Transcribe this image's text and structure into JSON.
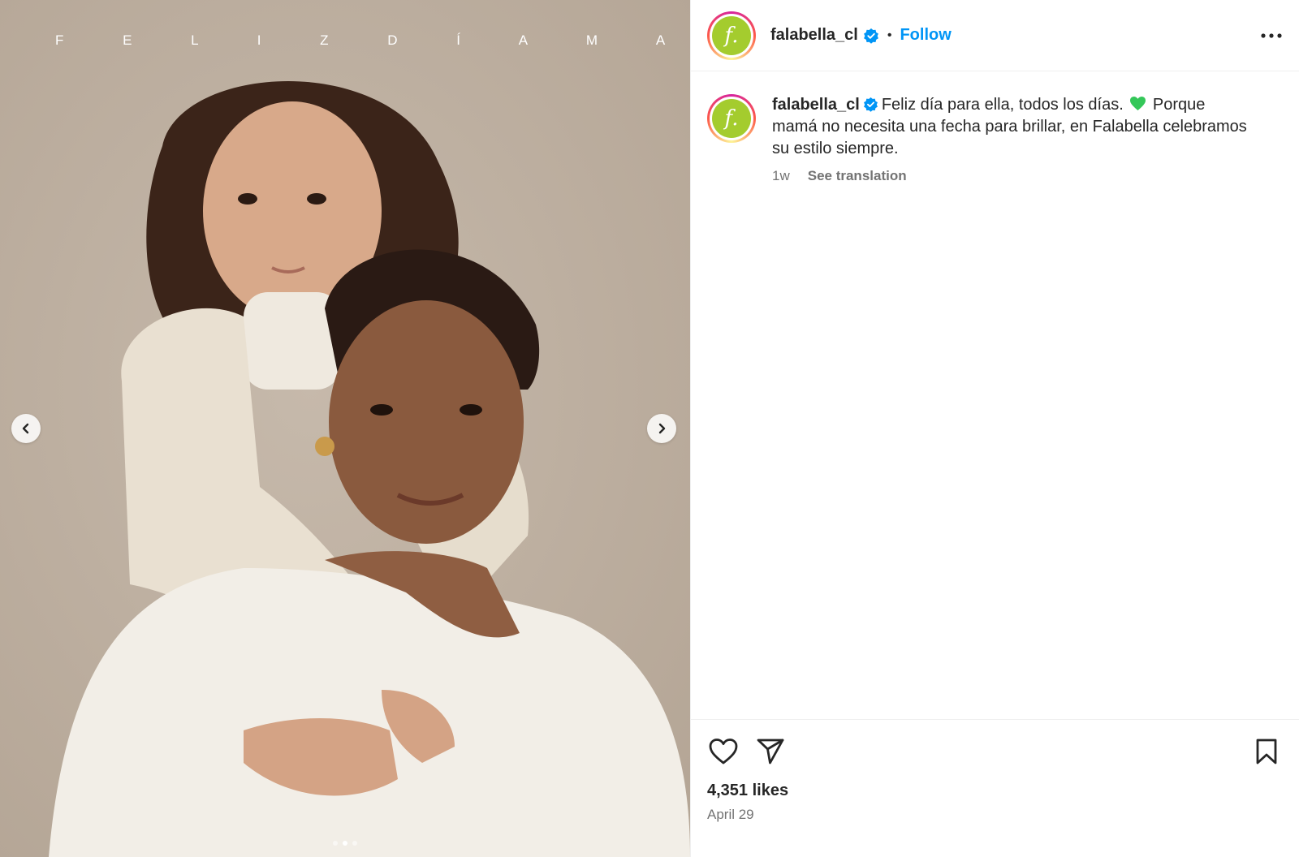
{
  "media": {
    "overlay_text": "F E L I Z   D Í A   M A M Á",
    "prev_icon": "chevron-left-icon",
    "next_icon": "chevron-right-icon",
    "carousel": {
      "count": 3,
      "active": 2
    }
  },
  "header": {
    "username": "falabella_cl",
    "separator": "•",
    "follow_label": "Follow",
    "avatar_glyph": "f.",
    "more_icon": "more-icon"
  },
  "caption": {
    "username": "falabella_cl",
    "text_before_emoji": "Feliz día para ella, todos los días.",
    "text_after_emoji": "Porque mamá no necesita una fecha para brillar, en Falabella celebramos su estilo siempre.",
    "age": "1w",
    "see_translation": "See translation"
  },
  "actions": {
    "like_icon": "heart-icon",
    "share_icon": "send-icon",
    "save_icon": "bookmark-icon"
  },
  "likes_text": "4,351 likes",
  "date_text": "April 29",
  "colors": {
    "accent": "#0095f6",
    "brand_green": "#a4cc2e",
    "photo_background": "#bcae9f",
    "emoji_heart": "#34c759"
  }
}
